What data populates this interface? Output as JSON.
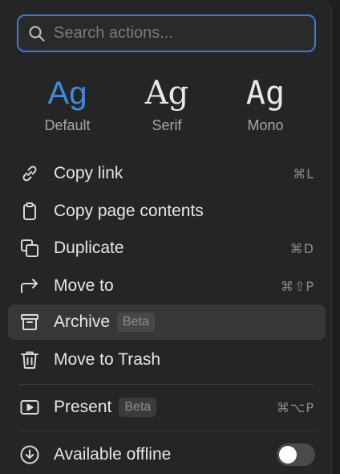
{
  "search": {
    "placeholder": "Search actions..."
  },
  "fonts": [
    {
      "glyph": "Ag",
      "label": "Default",
      "active": true
    },
    {
      "glyph": "Ag",
      "label": "Serif",
      "active": false
    },
    {
      "glyph": "Ag",
      "label": "Mono",
      "active": false
    }
  ],
  "actions": {
    "copy_link": {
      "label": "Copy link",
      "icon": "link-icon",
      "shortcut": "⌘L"
    },
    "copy_contents": {
      "label": "Copy page contents",
      "icon": "clipboard-icon"
    },
    "duplicate": {
      "label": "Duplicate",
      "icon": "duplicate-icon",
      "shortcut": "⌘D"
    },
    "move_to": {
      "label": "Move to",
      "icon": "move-arrow-icon",
      "shortcut": "⌘⇧P"
    },
    "archive": {
      "label": "Archive",
      "icon": "archive-icon",
      "badge": "Beta"
    },
    "trash": {
      "label": "Move to Trash",
      "icon": "trash-icon"
    },
    "present": {
      "label": "Present",
      "icon": "play-icon",
      "badge": "Beta",
      "shortcut": "⌘⌥P"
    },
    "offline": {
      "label": "Available offline",
      "icon": "download-circle-icon",
      "toggle_on": false
    }
  },
  "colors": {
    "accent": "#3f8ae0",
    "focus_border": "#3a7bd5",
    "menu_bg": "#252525",
    "hover_bg": "#373737"
  }
}
